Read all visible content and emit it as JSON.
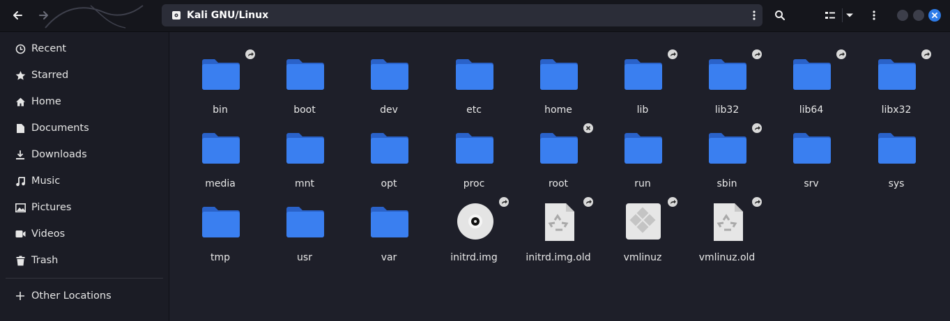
{
  "header": {
    "location": "Kali GNU/Linux"
  },
  "sidebar": {
    "items": [
      {
        "label": "Recent",
        "icon": "clock-icon"
      },
      {
        "label": "Starred",
        "icon": "star-icon"
      },
      {
        "label": "Home",
        "icon": "home-icon"
      },
      {
        "label": "Documents",
        "icon": "document-icon"
      },
      {
        "label": "Downloads",
        "icon": "download-icon"
      },
      {
        "label": "Music",
        "icon": "music-icon"
      },
      {
        "label": "Pictures",
        "icon": "picture-icon"
      },
      {
        "label": "Videos",
        "icon": "video-icon"
      }
    ],
    "trash": "Trash",
    "other_locations": "Other Locations"
  },
  "files": {
    "items": [
      {
        "name": "bin",
        "type": "folder",
        "emblem": "symlink"
      },
      {
        "name": "boot",
        "type": "folder",
        "emblem": ""
      },
      {
        "name": "dev",
        "type": "folder",
        "emblem": ""
      },
      {
        "name": "etc",
        "type": "folder",
        "emblem": ""
      },
      {
        "name": "home",
        "type": "folder",
        "emblem": ""
      },
      {
        "name": "lib",
        "type": "folder",
        "emblem": "symlink"
      },
      {
        "name": "lib32",
        "type": "folder",
        "emblem": "symlink"
      },
      {
        "name": "lib64",
        "type": "folder",
        "emblem": "symlink"
      },
      {
        "name": "libx32",
        "type": "folder",
        "emblem": "symlink"
      },
      {
        "name": "media",
        "type": "folder",
        "emblem": ""
      },
      {
        "name": "mnt",
        "type": "folder",
        "emblem": ""
      },
      {
        "name": "opt",
        "type": "folder",
        "emblem": ""
      },
      {
        "name": "proc",
        "type": "folder",
        "emblem": ""
      },
      {
        "name": "root",
        "type": "folder",
        "emblem": "unreadable"
      },
      {
        "name": "run",
        "type": "folder",
        "emblem": ""
      },
      {
        "name": "sbin",
        "type": "folder",
        "emblem": "symlink"
      },
      {
        "name": "srv",
        "type": "folder",
        "emblem": ""
      },
      {
        "name": "sys",
        "type": "folder",
        "emblem": ""
      },
      {
        "name": "tmp",
        "type": "folder",
        "emblem": ""
      },
      {
        "name": "usr",
        "type": "folder",
        "emblem": ""
      },
      {
        "name": "var",
        "type": "folder",
        "emblem": ""
      },
      {
        "name": "initrd.img",
        "type": "disc",
        "emblem": "symlink"
      },
      {
        "name": "initrd.img.old",
        "type": "recycle",
        "emblem": "symlink"
      },
      {
        "name": "vmlinuz",
        "type": "binary",
        "emblem": "symlink"
      },
      {
        "name": "vmlinuz.old",
        "type": "recycle",
        "emblem": "symlink"
      }
    ]
  },
  "colors": {
    "folder": "#3a7ff0",
    "folder_tab": "#2a62c9",
    "accent": "#2e7ce8",
    "background": "#1e1f29",
    "sidebar": "#1b1c25"
  }
}
